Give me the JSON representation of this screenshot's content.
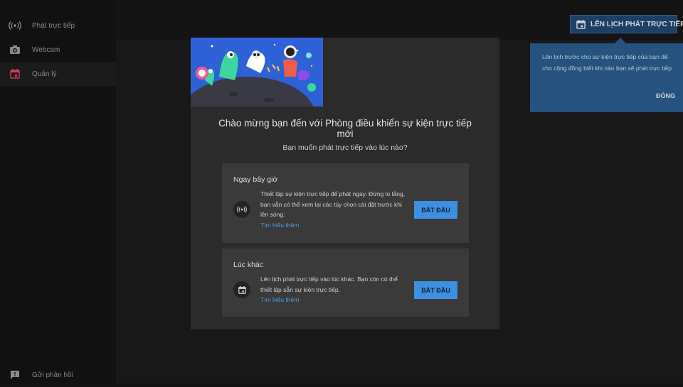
{
  "sidebar": {
    "items": [
      {
        "label": "Phát trực tiếp",
        "icon": "broadcast-icon"
      },
      {
        "label": "Webcam",
        "icon": "camera-icon"
      },
      {
        "label": "Quản lý",
        "icon": "calendar-icon",
        "active": true
      }
    ],
    "feedback": {
      "label": "Gửi phản hồi",
      "icon": "feedback-icon"
    }
  },
  "header": {
    "schedule_button": {
      "label": "LÊN LỊCH PHÁT TRỰC TIẾP",
      "icon": "calendar-icon"
    }
  },
  "tooltip": {
    "text": "Lên lịch trước cho sự kiện trực tiếp của bạn để cho cộng đồng biết khi nào bạn sẽ phát trực tiếp.",
    "close_label": "ĐÓNG"
  },
  "dialog": {
    "title": "Chào mừng bạn đến với Phòng điều khiển sự kiện trực tiếp mới",
    "subtitle": "Bạn muốn phát trực tiếp vào lúc nào?",
    "options": [
      {
        "title": "Ngay bây giờ",
        "icon": "broadcast-icon",
        "description": "Thiết lập sự kiện trực tiếp để phát ngay. Đừng lo lắng, bạn vẫn có thể xem lại các tùy chọn cài đặt trước khi lên sóng.",
        "link": "Tìm hiểu thêm",
        "button": "BẮT ĐẦU"
      },
      {
        "title": "Lúc khác",
        "icon": "calendar-icon",
        "description": "Lên lịch phát trực tiếp vào lúc khác. Bạn còn có thể thiết lập sẵn sự kiện trực tiếp.",
        "link": "Tìm hiểu thêm",
        "button": "BẮT ĐẦU"
      }
    ]
  },
  "colors": {
    "accent": "#3d8fe0",
    "active_icon": "#d0395a",
    "tooltip_bg": "#25527f",
    "dialog_bg": "#2b2b2b"
  }
}
